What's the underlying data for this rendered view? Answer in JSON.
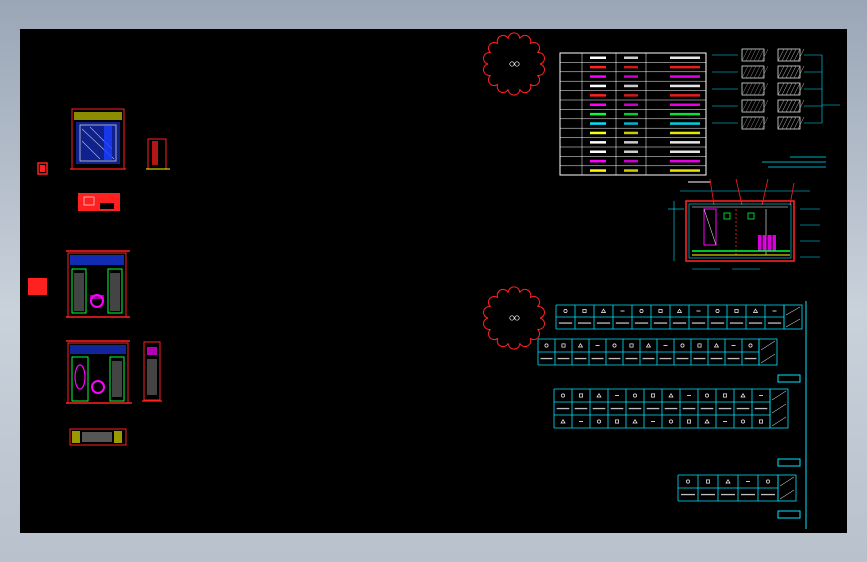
{
  "viewport": {
    "background": "#000000",
    "frame_background": "#b4becb"
  },
  "colors": {
    "red": "#ff2020",
    "cyan": "#00e5ff",
    "magenta": "#ff00ff",
    "green": "#00ff3c",
    "yellow": "#ffff00",
    "white": "#ffffff",
    "blue": "#1a3dff",
    "gray": "#7a7a7a"
  },
  "icons": {
    "cloud_symbol": "revision-cloud-icon",
    "red_block": "red-block-icon"
  },
  "tables": {
    "top_rows": 13,
    "mid_symbol_cols": 12
  }
}
